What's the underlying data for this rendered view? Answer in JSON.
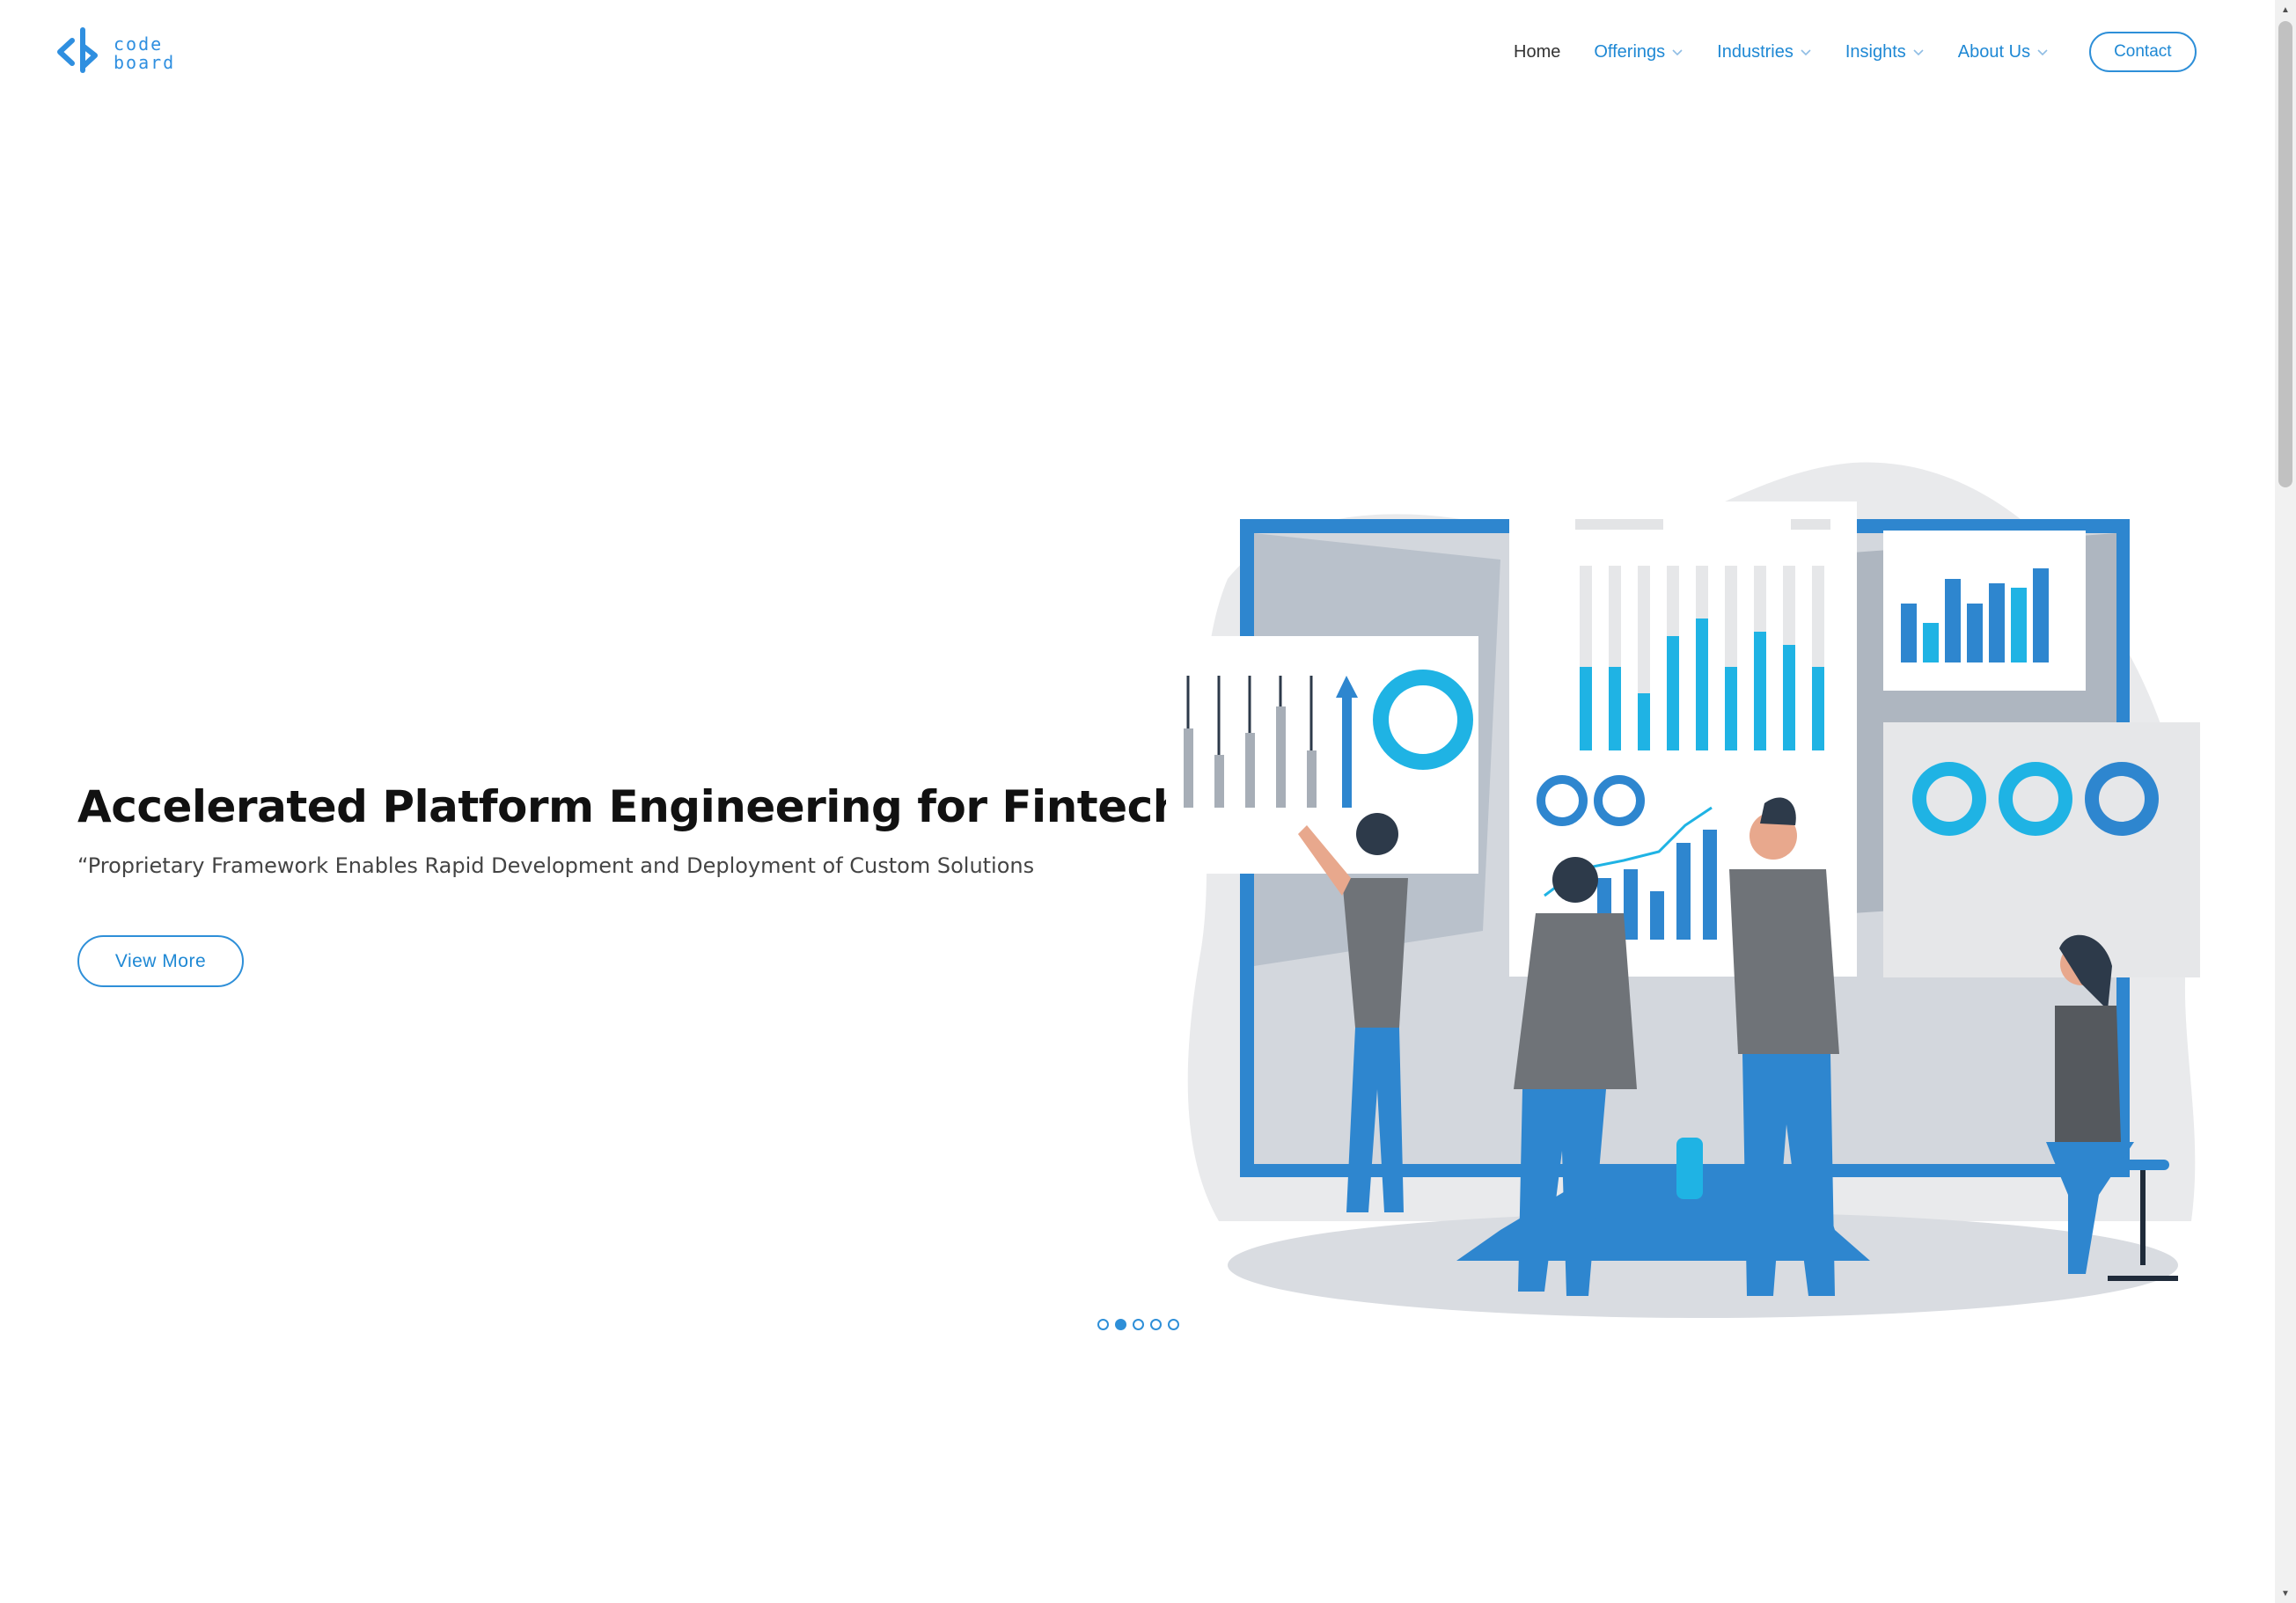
{
  "brand": {
    "logo_line1": "code",
    "logo_line2": "board",
    "accent": "#1e88d4"
  },
  "nav": {
    "items": [
      {
        "label": "Home",
        "has_dropdown": false
      },
      {
        "label": "Offerings",
        "has_dropdown": true
      },
      {
        "label": "Industries",
        "has_dropdown": true
      },
      {
        "label": "Insights",
        "has_dropdown": true
      },
      {
        "label": "About Us",
        "has_dropdown": true
      }
    ],
    "contact_label": "Contact"
  },
  "hero": {
    "title": "Accelerated Platform Engineering for Fintech",
    "subtitle": "“Proprietary Framework Enables Rapid Development and Deployment of Custom Solutions",
    "cta_label": "View More"
  },
  "slider": {
    "count": 5,
    "active_index": 1
  },
  "icons": {
    "dropdown": "chevron-down-icon",
    "scroll_up": "scroll-up-arrow-icon",
    "scroll_down": "scroll-down-arrow-icon"
  }
}
